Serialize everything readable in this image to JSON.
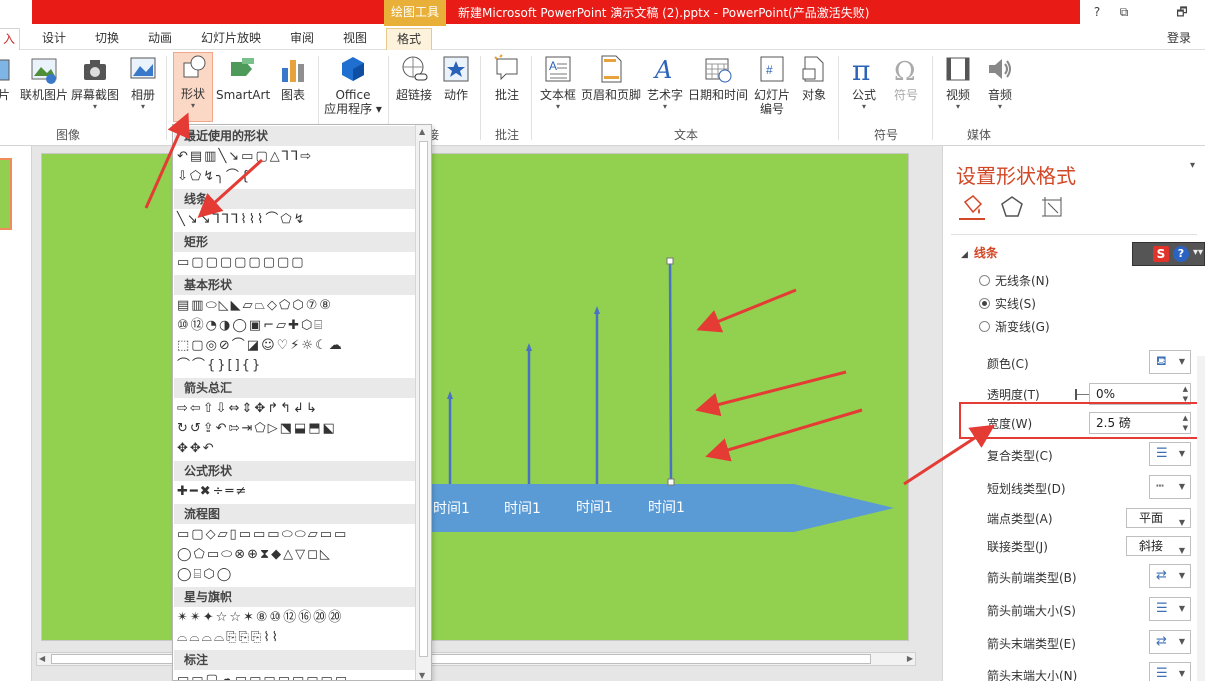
{
  "titlebar": {
    "context_tab": "绘图工具",
    "title": "新建Microsoft PowerPoint 演示文稿 (2).pptx - PowerPoint(产品激活失败)",
    "help": "?",
    "restore": "⧉",
    "minimize": "🗗"
  },
  "tabs": {
    "insert": "入",
    "design": "设计",
    "transitions": "切换",
    "animations": "动画",
    "slideshow": "幻灯片放映",
    "review": "审阅",
    "view": "视图",
    "format": "格式",
    "login": "登录"
  },
  "ribbon": {
    "pictures_partial": "片",
    "online_pictures": "联机图片",
    "screenshot": "屏幕截图",
    "album": "相册",
    "shapes": "形状",
    "smartart": "SmartArt",
    "chart": "图表",
    "office_apps_1": "Office",
    "office_apps_2": "应用程序",
    "hyperlink": "超链接",
    "action": "动作",
    "comment": "批注",
    "textbox": "文本框",
    "header_footer": "页眉和页脚",
    "wordart": "艺术字",
    "datetime": "日期和时间",
    "slide_number_1": "幻灯片",
    "slide_number_2": "编号",
    "object": "对象",
    "equation": "公式",
    "symbol": "符号",
    "video": "视频",
    "audio": "音频",
    "group_images": "图像",
    "group_links": "接",
    "group_comments": "批注",
    "group_text": "文本",
    "group_symbols": "符号",
    "group_media": "媒体"
  },
  "shapes_panel": {
    "sections": {
      "recent": "最近使用的形状",
      "lines": "线条",
      "rect": "矩形",
      "basic": "基本形状",
      "arrows": "箭头总汇",
      "equation": "公式形状",
      "flowchart": "流程图",
      "stars": "星与旗帜",
      "callouts": "标注"
    },
    "rows": {
      "recent1": "↶▤▥╲↘▭▢△⅂⅂⇨",
      "recent2": "⇩⬠↯╮⌒{",
      "lines1": "╲↘↘⅂⅂⅂⌇⌇⌇⌒⬠↯",
      "rect1": "▭▢▢▢▢▢▢▢▢",
      "basic1": "▤▥⬭◺◣▱⏢◇⬠⬡⑦⑧",
      "basic2": "⑩⑫◔◑◯▣⌐▱✚⬡⌸",
      "basic3": "⬚▢◎⊘⌒◪☺♡⚡☼☾☁",
      "basic4": "⌒⌒{}[]{}",
      "arrows1": "⇨⇦⇧⇩⇔⇕✥↱↰↲↳",
      "arrows2": "↻↺⇪↶⇰⇥⬠▷⬔⬓⬒⬕",
      "arrows3": "✥✥↶",
      "eq1": "✚━✖÷═≠",
      "flow1": "▭▢◇▱▯▭▭▭⬭⬭▱▭▭",
      "flow2": "◯⬠▭⬭⊗⊕⧗◆△▽◻◺",
      "flow3": "◯⌸⬡◯",
      "stars1": "✴✴✦☆☆✶⑧⑩⑫⑯⑳⑳",
      "stars2": "⌓⌓⌓⌓⎘⎘⎘⌇⌇",
      "callouts1": "▭▭▢☁▭▭▭▭▭▭▭▭"
    }
  },
  "slide": {
    "labels": [
      "时间1",
      "时间1",
      "时间1",
      "时间1"
    ],
    "background": "#92d050",
    "band_color": "#5b9bd5",
    "line_color": "#4a72c4"
  },
  "pane": {
    "title": "设置形状格式",
    "close": "▾",
    "section": "线条",
    "no_line": "无线条(N)",
    "solid_line": "实线(S)",
    "gradient_line": "渐变线(G)",
    "color": "颜色(C)",
    "transparency": "透明度(T)",
    "transparency_value": "0%",
    "width": "宽度(W)",
    "width_value": "2.5 磅",
    "compound": "复合类型(C)",
    "dash": "短划线类型(D)",
    "cap": "端点类型(A)",
    "cap_value": "平面",
    "join": "联接类型(J)",
    "join_value": "斜接",
    "begin_type": "箭头前端类型(B)",
    "begin_size": "箭头前端大小(S)",
    "end_type": "箭头末端类型(E)",
    "end_size": "箭头末端大小(N)"
  },
  "ime": {
    "s": "S",
    "help": "?",
    "chev": "▾▾"
  },
  "colors": {
    "title_red": "#e81b16",
    "context_gold": "#e8b038",
    "accent": "#d24726",
    "annotation_red": "#e53b35"
  }
}
